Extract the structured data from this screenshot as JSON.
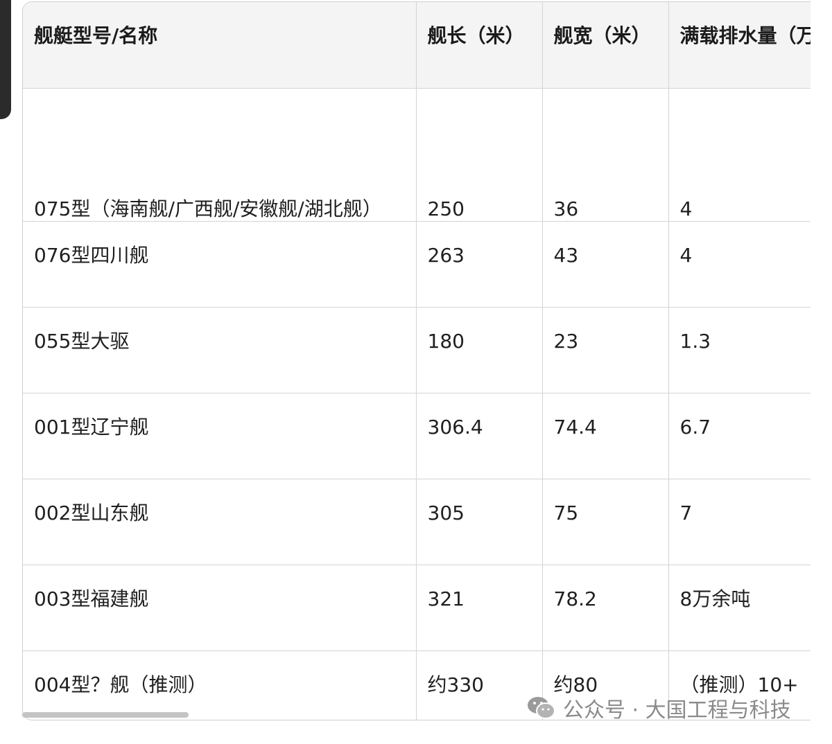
{
  "table": {
    "headers": [
      "舰艇型号/名称",
      "舰长（米）",
      "舰宽（米）",
      "满载排水量（万"
    ],
    "rows": [
      [
        "075型（海南舰/广西舰/安徽舰/湖北舰）",
        "250",
        "36",
        "4"
      ],
      [
        "076型四川舰",
        "263",
        "43",
        "4"
      ],
      [
        "055型大驱",
        "180",
        "23",
        "1.3"
      ],
      [
        "001型辽宁舰",
        "306.4",
        "74.4",
        "6.7"
      ],
      [
        "002型山东舰",
        "305",
        "75",
        "7"
      ],
      [
        "003型福建舰",
        "321",
        "78.2",
        "8万余吨"
      ],
      [
        "004型？舰（推测）",
        "约330",
        "约80",
        "（推测）10+"
      ]
    ]
  },
  "watermark": {
    "text": "公众号 · 大国工程与科技",
    "icon": "wechat-icon",
    "color": "#8a8a8a"
  }
}
